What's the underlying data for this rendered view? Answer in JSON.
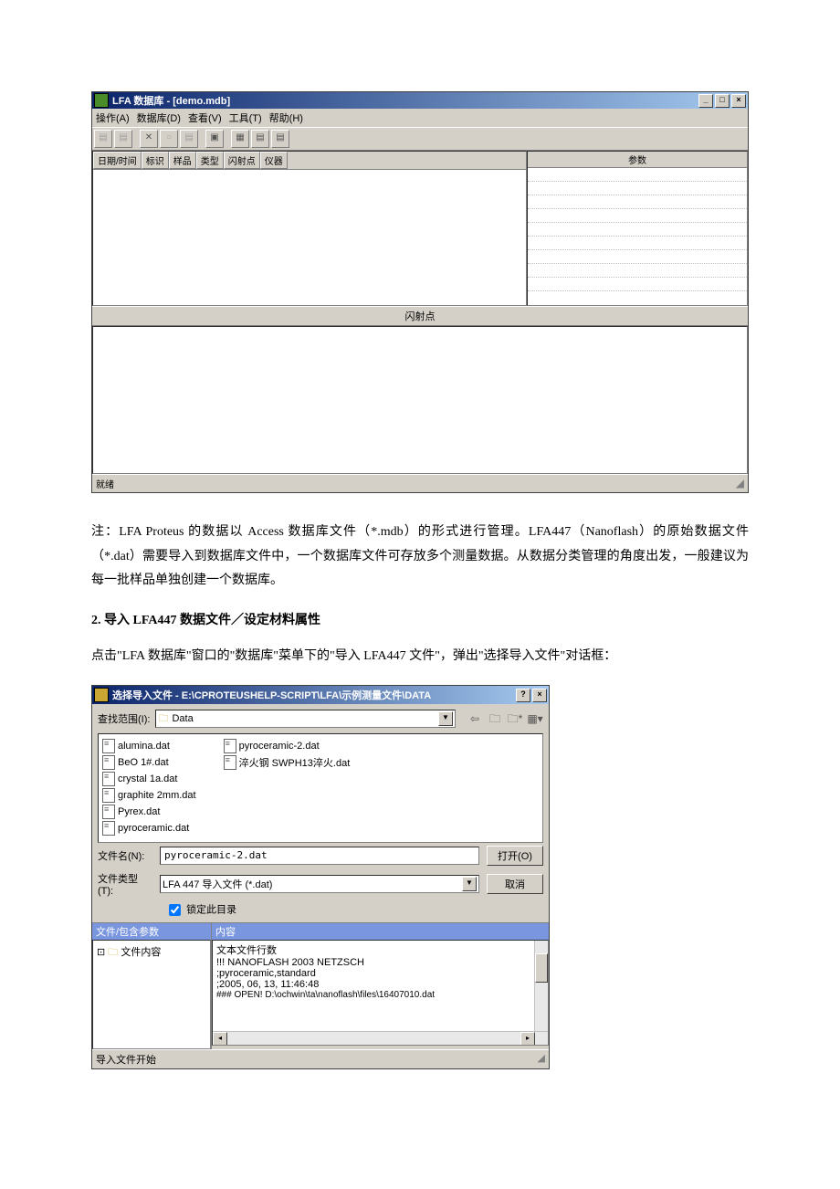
{
  "win1": {
    "title": "LFA 数据库 - [demo.mdb]",
    "menu": [
      "操作(A)",
      "数据库(D)",
      "查看(V)",
      "工具(T)",
      "帮助(H)"
    ],
    "left_cols": [
      "日期/时间",
      "标识",
      "样品",
      "类型",
      "闪射点",
      "仪器"
    ],
    "right_header": "参数",
    "mid_label": "闪射点",
    "status": "就绪"
  },
  "para_note": "注：LFA Proteus 的数据以 Access 数据库文件（*.mdb）的形式进行管理。LFA447（Nanoflash）的原始数据文件（*.dat）需要导入到数据库文件中，一个数据库文件可存放多个测量数据。从数据分类管理的角度出发，一般建议为每一批样品单独创建一个数据库。",
  "heading2": "2. 导入 LFA447 数据文件／设定材料属性",
  "para2": "点击\"LFA 数据库\"窗口的\"数据库\"菜单下的\"导入 LFA447 文件\"，弹出\"选择导入文件\"对话框：",
  "dlg": {
    "title": "选择导入文件 - E:\\CPROTEUSHELP-SCRIPT\\LFA\\示例测量文件\\DATA",
    "lookin_label": "查找范围(I):",
    "lookin_value": "Data",
    "files_col1": [
      "alumina.dat",
      "BeO 1#.dat",
      "crystal 1a.dat",
      "graphite 2mm.dat",
      "Pyrex.dat",
      "pyroceramic.dat"
    ],
    "files_col2": [
      "pyroceramic-2.dat",
      "淬火钢 SWPH13淬火.dat"
    ],
    "filename_label": "文件名(N):",
    "filename_value": "pyroceramic-2.dat",
    "filetype_label": "文件类型(T):",
    "filetype_value": "LFA 447 导入文件 (*.dat)",
    "open_btn": "打开(O)",
    "cancel_btn": "取消",
    "lock_dir": "锁定此目录",
    "left_hdr": "文件/包含参数",
    "right_hdr": "内容",
    "tree_item": "文件内容",
    "content_lines": [
      "文本文件行数",
      "!!! NANOFLASH   2003   NETZSCH",
      ";pyroceramic,standard",
      ";2005, 06, 13, 11:46:48",
      "",
      "### OPEN! D:\\ochwin\\ta\\nanoflash\\files\\16407010.dat"
    ],
    "status": "导入文件开始"
  }
}
